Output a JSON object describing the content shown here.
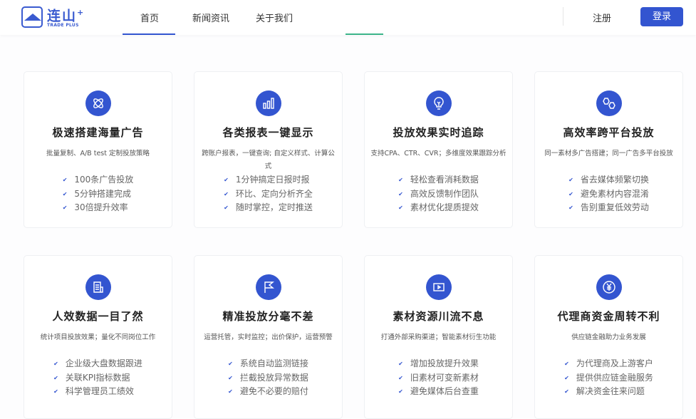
{
  "header": {
    "logo_cn": "连山",
    "logo_plus": "+",
    "logo_en": "TRADE PLUS",
    "nav": [
      "首页",
      "新闻资讯",
      "关于我们"
    ],
    "register": "注册",
    "login": "登录"
  },
  "colors": {
    "accent": "#3355d0",
    "green": "#3cb48a"
  },
  "cards": [
    {
      "icon": "atom-icon",
      "title": "极速搭建海量广告",
      "desc": "批量复制、A/B test 定制投放策略",
      "items": [
        "100条广告投放",
        "5分钟搭建完成",
        "30倍提升效率"
      ]
    },
    {
      "icon": "bar-chart-icon",
      "title": "各类报表一键显示",
      "desc": "跨账户报表，一键查询; 自定义样式、计算公式",
      "items": [
        "1分钟搞定日报时报",
        "环比、定向分析齐全",
        "随时掌控，定时推送"
      ]
    },
    {
      "icon": "lightbulb-icon",
      "title": "投放效果实时追踪",
      "desc": "支持CPA、CTR、CVR；多维度效果跟踪分析",
      "items": [
        "轻松查看消耗数据",
        "高效反馈制作团队",
        "素材优化提质提效"
      ]
    },
    {
      "icon": "hexagons-icon",
      "title": "高效率跨平台投放",
      "desc": "同一素材多广告搭建；同一广告多平台投放",
      "items": [
        "省去媒体频繁切换",
        "避免素材内容混淆",
        "告别重复低效劳动"
      ]
    },
    {
      "icon": "document-icon",
      "title": "人效数据一目了然",
      "desc": "统计项目投放效果；量化不同岗位工作",
      "items": [
        "企业级大盘数据跟进",
        "关联KPI指标数据",
        "科学管理员工绩效"
      ]
    },
    {
      "icon": "flag-icon",
      "title": "精准投放分毫不差",
      "desc": "运营托管，实时监控；出价保护，运营预警",
      "items": [
        "系统自动监测链接",
        "拦截投放异常数据",
        "避免不必要的赔付"
      ]
    },
    {
      "icon": "video-icon",
      "title": "素材资源川流不息",
      "desc": "打通外部采购渠道；智能素材衍生功能",
      "items": [
        "增加投放提升效果",
        "旧素材可变新素材",
        "避免媒体后台查重"
      ]
    },
    {
      "icon": "yuan-icon",
      "title": "代理商资金周转不利",
      "desc": "供应链金融助力业务发展",
      "items": [
        "为代理商及上游客户",
        "提供供应链金融服务",
        "解决资金往来问题"
      ]
    }
  ]
}
